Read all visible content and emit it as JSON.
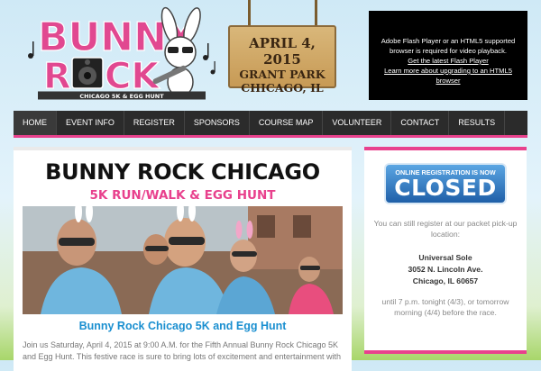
{
  "logo": {
    "line1": "BUNNY",
    "line2": "R",
    "line2_rest": "CK",
    "tagline": "CHICAGO 5K & EGG HUNT"
  },
  "date_sign": {
    "line1": "APRIL 4, 2015",
    "line2": "GRANT PARK",
    "line3": "CHICAGO, IL"
  },
  "flash_notice": {
    "line1": "Adobe Flash Player or an HTML5 supported browser is required for video playback.",
    "link1": "Get the latest Flash Player",
    "link2": "Learn more about upgrading to an HTML5 browser"
  },
  "nav": {
    "items": [
      {
        "label": "Home"
      },
      {
        "label": "Event Info"
      },
      {
        "label": "Register"
      },
      {
        "label": "Sponsors"
      },
      {
        "label": "Course Map"
      },
      {
        "label": "Volunteer"
      },
      {
        "label": "Contact"
      },
      {
        "label": "Results"
      }
    ]
  },
  "main": {
    "title": "BUNNY ROCK CHICAGO",
    "subtitle": "5K RUN/WALK & EGG HUNT",
    "article_heading": "Bunny Rock Chicago 5K and Egg Hunt",
    "article_text": "Join us Saturday, April 4, 2015 at 9:00 A.M. for the Fifth Annual Bunny Rock Chicago 5K and Egg Hunt. This festive race is sure to bring lots of excitement and entertainment with"
  },
  "sidebar": {
    "badge_small": "ONLINE REGISTRATION IS NOW",
    "badge_big": "CLOSED",
    "intro": "You can still register at our packet pick-up location:",
    "location_name": "Universal Sole",
    "address": "3052 N. Lincoln Ave.",
    "city": "Chicago, IL 60657",
    "hours": "until 7 p.m. tonight (4/3), or tomorrow morning (4/4) before the race."
  },
  "colors": {
    "accent_pink": "#e8418d",
    "link_blue": "#1a8fd0",
    "nav_bg": "#2b2b2b"
  }
}
